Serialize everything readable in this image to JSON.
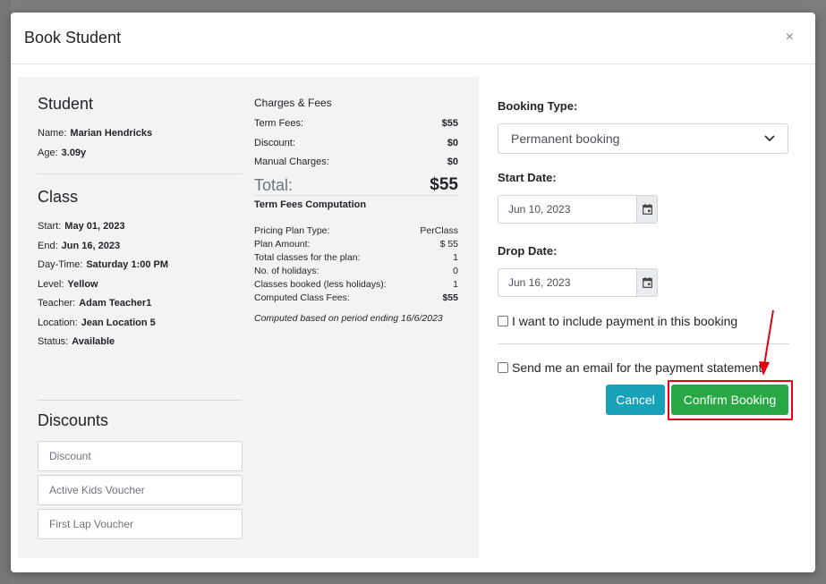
{
  "modal": {
    "title": "Book Student",
    "close_label": "×"
  },
  "student": {
    "heading": "Student",
    "name_label": "Name:",
    "name": "Marian Hendricks",
    "age_label": "Age:",
    "age": "3.09y"
  },
  "class": {
    "heading": "Class",
    "rows": [
      {
        "label": "Start:",
        "value": "May 01, 2023"
      },
      {
        "label": "End:",
        "value": "Jun 16, 2023"
      },
      {
        "label": "Day-Time:",
        "value": "Saturday 1:00 PM"
      },
      {
        "label": "Level:",
        "value": "Yellow"
      },
      {
        "label": "Teacher:",
        "value": "Adam Teacher1"
      },
      {
        "label": "Location:",
        "value": "Jean Location 5"
      },
      {
        "label": "Status:",
        "value": "Available"
      }
    ]
  },
  "discounts": {
    "heading": "Discounts",
    "placeholders": [
      "Discount",
      "Active Kids Voucher",
      "First Lap Voucher"
    ]
  },
  "charges": {
    "heading": "Charges & Fees",
    "rows": [
      {
        "label": "Term Fees:",
        "value": "$55"
      },
      {
        "label": "Discount:",
        "value": "$0"
      },
      {
        "label": "Manual Charges:",
        "value": "$0"
      }
    ],
    "total_label": "Total:",
    "total_value": "$55",
    "computation_heading": "Term Fees Computation",
    "computation": [
      {
        "label": "Pricing Plan Type:",
        "value": "PerClass"
      },
      {
        "label": "Plan Amount:",
        "value": "$ 55"
      },
      {
        "label": "Total classes for the plan:",
        "value": "1"
      },
      {
        "label": "No. of holidays:",
        "value": "0"
      },
      {
        "label": "Classes booked (less holidays):",
        "value": "1"
      },
      {
        "label": "Computed Class Fees:",
        "value": "$55"
      }
    ],
    "note": "Computed based on period ending 16/6/2023"
  },
  "form": {
    "booking_type_label": "Booking Type:",
    "booking_type_value": "Permanent booking",
    "start_date_label": "Start Date:",
    "start_date_value": "Jun 10, 2023",
    "drop_date_label": "Drop Date:",
    "drop_date_value": "Jun 16, 2023",
    "include_payment_label": "I want to include payment in this booking",
    "email_label": "Send me an email for the payment statement"
  },
  "buttons": {
    "cancel": "Cancel",
    "confirm": "Confirm Booking"
  },
  "colors": {
    "cancel": "#17a2b8",
    "confirm": "#28a745",
    "highlight": "#e3000f"
  }
}
